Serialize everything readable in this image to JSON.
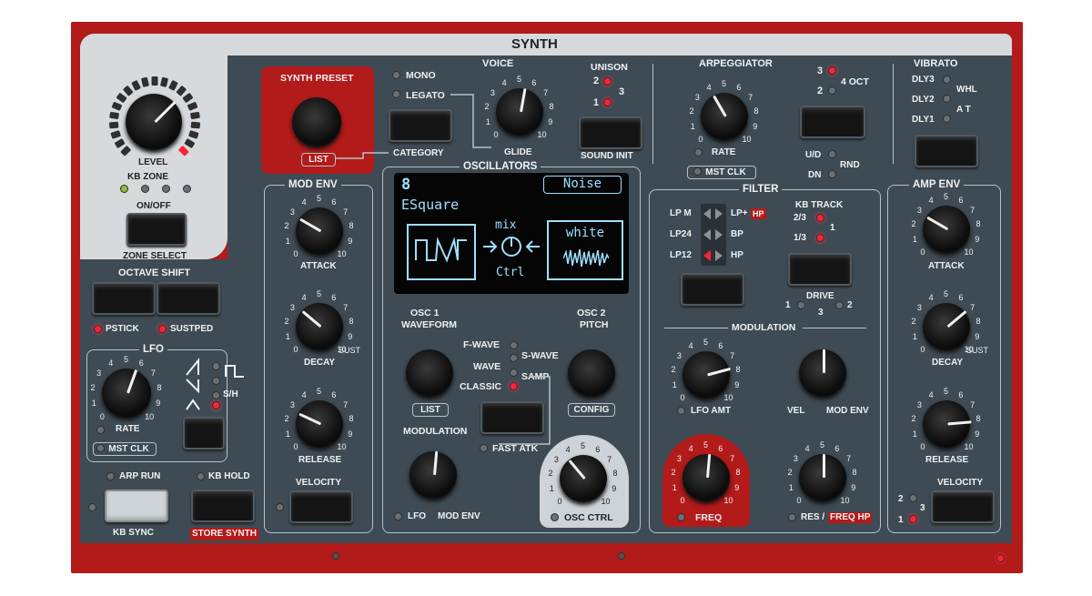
{
  "header": {
    "title": "SYNTH"
  },
  "level": {
    "label": "LEVEL"
  },
  "kb_zone": {
    "label": "KB ZONE",
    "on_off": "ON/OFF",
    "zone_select": "ZONE SELECT"
  },
  "synth_preset": {
    "title": "SYNTH PRESET",
    "list": "LIST",
    "category": "CATEGORY"
  },
  "voice": {
    "title": "VOICE",
    "mono": "MONO",
    "legato": "LEGATO",
    "glide": "GLIDE",
    "unison": "UNISON",
    "u1": "1",
    "u2": "2",
    "u3": "3",
    "sound_init": "SOUND INIT"
  },
  "scale10": [
    "0",
    "1",
    "2",
    "3",
    "4",
    "5",
    "6",
    "7",
    "8",
    "9",
    "10"
  ],
  "arpeggiator": {
    "title": "ARPEGGIATOR",
    "rate": "RATE",
    "mst_clk": "MST CLK",
    "oct3": "3",
    "oct2": "2",
    "oct4": "4 OCT",
    "ud": "U/D",
    "dn": "DN",
    "rnd": "RND"
  },
  "vibrato": {
    "title": "VIBRATO",
    "dly3": "DLY3",
    "dly2": "DLY2",
    "dly1": "DLY1",
    "whl": "WHL",
    "at": "A T"
  },
  "octave_shift": {
    "title": "OCTAVE SHIFT",
    "pstick": "PSTICK",
    "sustped": "SUSTPED"
  },
  "lfo": {
    "title": "LFO",
    "rate": "RATE",
    "mst_clk": "MST CLK",
    "sh": "S/H"
  },
  "arp_run": "ARP RUN",
  "kb_hold": "KB HOLD",
  "kb_sync": "KB SYNC",
  "store_synth": "STORE SYNTH",
  "mod_env": {
    "title": "MOD ENV",
    "attack": "ATTACK",
    "decay": "DECAY",
    "sust": "SUST",
    "release": "RELEASE",
    "velocity": "VELOCITY"
  },
  "oscillators": {
    "title": "OSCILLATORS",
    "osc1_waveform": "OSC 1\nWAVEFORM",
    "osc1_line1": "OSC 1",
    "osc1_line2": "WAVEFORM",
    "osc2_line1": "OSC 2",
    "osc2_line2": "PITCH",
    "list": "LIST",
    "config": "CONFIG",
    "fwave": "F-WAVE",
    "swave": "S-WAVE",
    "wave": "WAVE",
    "classic": "CLASSIC",
    "samp": "SAMP",
    "fast_atk": "FAST ATK",
    "modulation": "MODULATION",
    "lfo": "LFO",
    "mod_env": "MOD ENV",
    "osc_ctrl": "OSC CTRL"
  },
  "display": {
    "number": "8",
    "name": "ESquare",
    "mode": "Noise",
    "mix": "mix",
    "ctrl": "Ctrl",
    "noise_type": "white"
  },
  "filter": {
    "title": "FILTER",
    "lpm": "LP M",
    "lphp": "LP+",
    "hp_tag": "HP",
    "lp24": "LP24",
    "bp": "BP",
    "lp12": "LP12",
    "hp": "HP",
    "kb_track": "KB TRACK",
    "kb23": "2/3",
    "kb1": "1",
    "kb13": "1/3",
    "drive": "DRIVE",
    "d1": "1",
    "d2": "2",
    "d3": "3",
    "modulation": "MODULATION",
    "lfo_amt": "LFO AMT",
    "vel": "VEL",
    "mod_env": "MOD ENV",
    "freq": "FREQ",
    "res": "RES /",
    "freq_hp": "FREQ HP"
  },
  "amp_env": {
    "title": "AMP ENV",
    "attack": "ATTACK",
    "decay": "DECAY",
    "sust": "SUST",
    "release": "RELEASE",
    "velocity": "VELOCITY",
    "v1": "1",
    "v2": "2",
    "v3": "3"
  },
  "colors": {
    "chassis": "#b31a1a",
    "panel": "#3e4b54",
    "led_on": "#ff2233",
    "display_text": "#8fd8ff"
  }
}
